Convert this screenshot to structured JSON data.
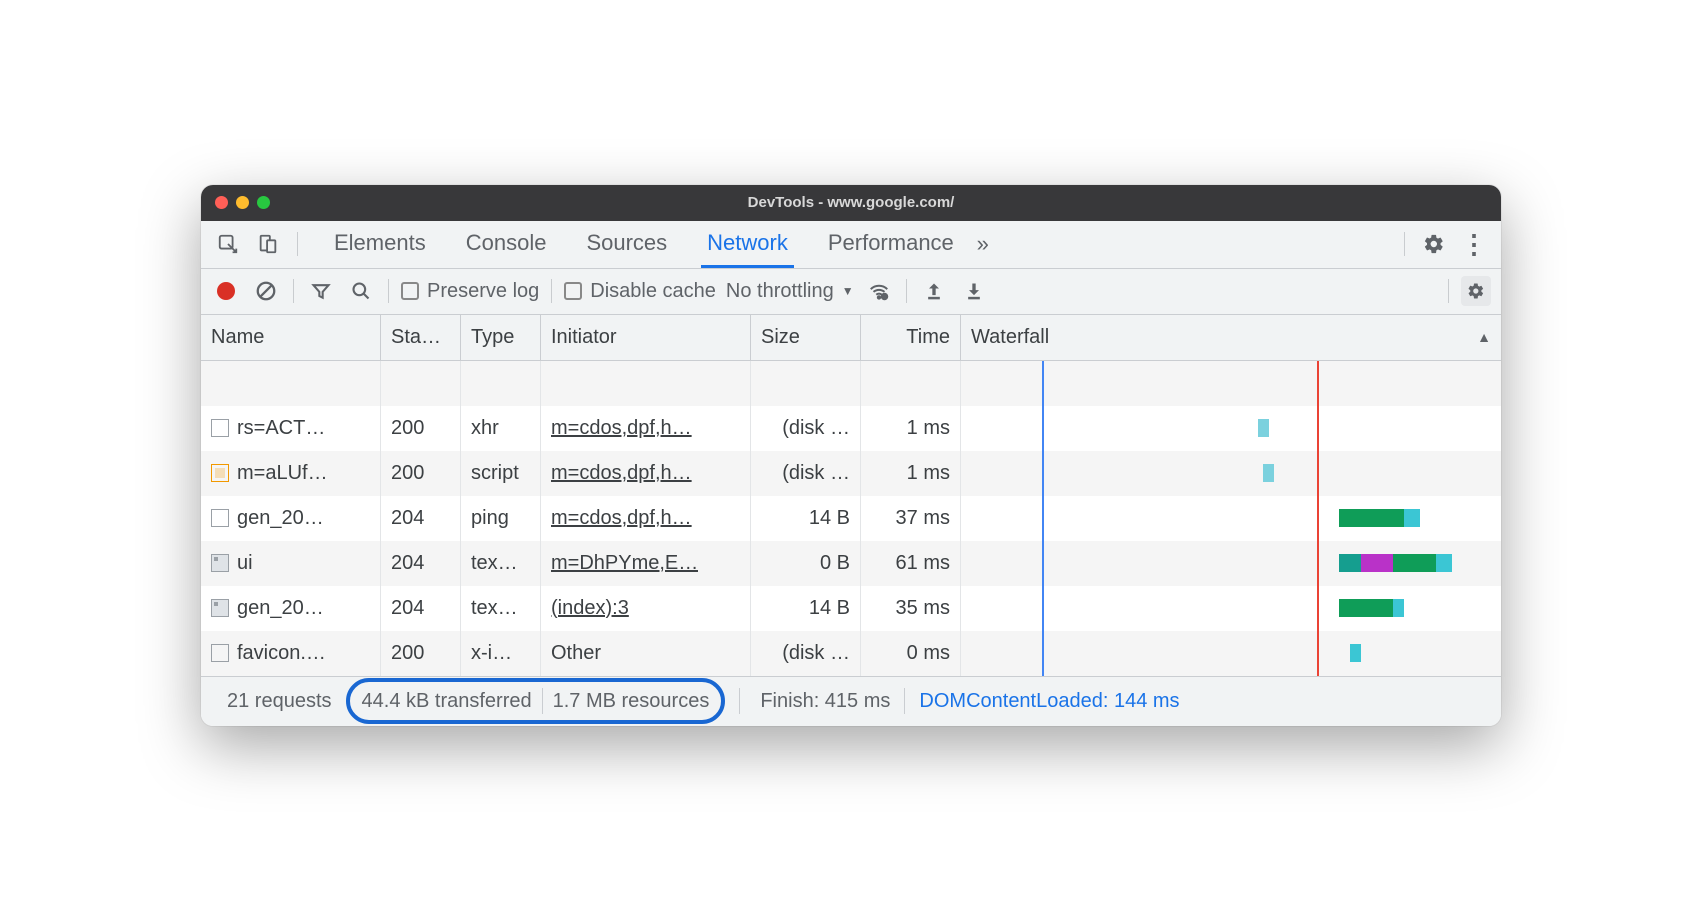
{
  "window": {
    "title": "DevTools - www.google.com/"
  },
  "tabs": {
    "elements": "Elements",
    "console": "Console",
    "sources": "Sources",
    "network": "Network",
    "performance": "Performance"
  },
  "toolbar": {
    "preserve_log": "Preserve log",
    "disable_cache": "Disable cache",
    "throttling": "No throttling"
  },
  "columns": {
    "name": "Name",
    "status": "Sta…",
    "type": "Type",
    "initiator": "Initiator",
    "size": "Size",
    "time": "Time",
    "waterfall": "Waterfall"
  },
  "rows": [
    {
      "icon": "doc",
      "name": "rs=ACT…",
      "status": "200",
      "type": "xhr",
      "initiator": "m=cdos,dpf,h…",
      "size": "(disk …",
      "time": "1 ms",
      "bars": [
        {
          "l": 55,
          "w": 2,
          "c": "#7bd1de"
        }
      ]
    },
    {
      "icon": "script",
      "name": "m=aLUf…",
      "status": "200",
      "type": "script",
      "initiator": "m=cdos,dpf,h…",
      "size": "(disk …",
      "time": "1 ms",
      "bars": [
        {
          "l": 56,
          "w": 2,
          "c": "#7bd1de"
        }
      ]
    },
    {
      "icon": "doc",
      "name": "gen_20…",
      "status": "204",
      "type": "ping",
      "initiator": "m=cdos,dpf,h…",
      "size": "14 B",
      "time": "37 ms",
      "bars": [
        {
          "l": 70,
          "w": 12,
          "c": "#0f9d58"
        },
        {
          "l": 82,
          "w": 3,
          "c": "#3bc6d4"
        }
      ]
    },
    {
      "icon": "img",
      "name": "ui",
      "status": "204",
      "type": "tex…",
      "initiator": "m=DhPYme,E…",
      "size": "0 B",
      "time": "61 ms",
      "bars": [
        {
          "l": 70,
          "w": 4,
          "c": "#159e8f"
        },
        {
          "l": 74,
          "w": 6,
          "c": "#b932c8"
        },
        {
          "l": 80,
          "w": 8,
          "c": "#0f9d58"
        },
        {
          "l": 88,
          "w": 3,
          "c": "#3bc6d4"
        }
      ]
    },
    {
      "icon": "img",
      "name": "gen_20…",
      "status": "204",
      "type": "tex…",
      "initiator": "(index):3",
      "size": "14 B",
      "time": "35 ms",
      "bars": [
        {
          "l": 70,
          "w": 10,
          "c": "#0f9d58"
        },
        {
          "l": 80,
          "w": 2,
          "c": "#3bc6d4"
        }
      ]
    },
    {
      "icon": "doc",
      "name": "favicon.…",
      "status": "200",
      "type": "x-i…",
      "initiator": "Other",
      "initiator_plain": true,
      "size": "(disk …",
      "time": "0 ms",
      "bars": [
        {
          "l": 72,
          "w": 2,
          "c": "#3bc6d4"
        }
      ]
    }
  ],
  "vlines": {
    "blue_pct": 15,
    "red_pct": 66
  },
  "status": {
    "requests": "21 requests",
    "transferred": "44.4 kB transferred",
    "resources": "1.7 MB resources",
    "finish": "Finish: 415 ms",
    "dcl": "DOMContentLoaded: 144 ms"
  }
}
